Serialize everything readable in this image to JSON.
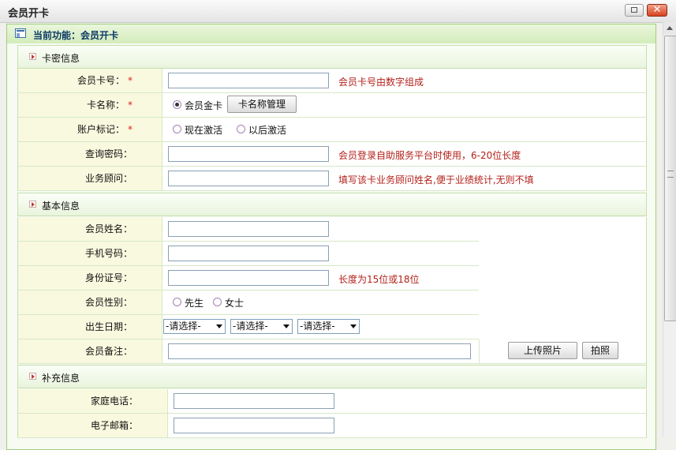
{
  "window": {
    "title": "会员开卡",
    "close_label": "✕"
  },
  "panel": {
    "title": "当前功能：会员开卡"
  },
  "sections": {
    "card": "卡密信息",
    "basic": "基本信息",
    "extra": "补充信息"
  },
  "card_fields": {
    "card_no": {
      "label": "会员卡号：",
      "value": "",
      "hint": "会员卡号由数字组成"
    },
    "card_name": {
      "label": "卡名称：",
      "option": "会员金卡",
      "manage_button": "卡名称管理"
    },
    "account": {
      "label": "账户标记：",
      "options": [
        "现在激活",
        "以后激活"
      ]
    },
    "query_pwd": {
      "label": "查询密码：",
      "value": "",
      "hint": "会员登录自助服务平台时使用，6-20位长度"
    },
    "advisor": {
      "label": "业务顾问：",
      "value": "",
      "hint": "填写该卡业务顾问姓名,便于业绩统计,无则不填"
    }
  },
  "required_mark": "*",
  "basic_fields": {
    "name": {
      "label": "会员姓名：",
      "value": ""
    },
    "phone": {
      "label": "手机号码：",
      "value": ""
    },
    "id_no": {
      "label": "身份证号：",
      "value": "",
      "hint": "长度为15位或18位"
    },
    "gender": {
      "label": "会员性别：",
      "options": [
        "先生",
        "女士"
      ]
    },
    "birth": {
      "label": "出生日期：",
      "selects": [
        "-请选择-",
        "-请选择-",
        "-请选择-"
      ]
    },
    "remark": {
      "label": "会员备注：",
      "value": ""
    }
  },
  "photo_buttons": {
    "upload": "上传照片",
    "capture": "拍照"
  },
  "extra_fields": {
    "home_phone": {
      "label": "家庭电话：",
      "value": ""
    },
    "email": {
      "label": "电子邮箱：",
      "value": ""
    }
  }
}
